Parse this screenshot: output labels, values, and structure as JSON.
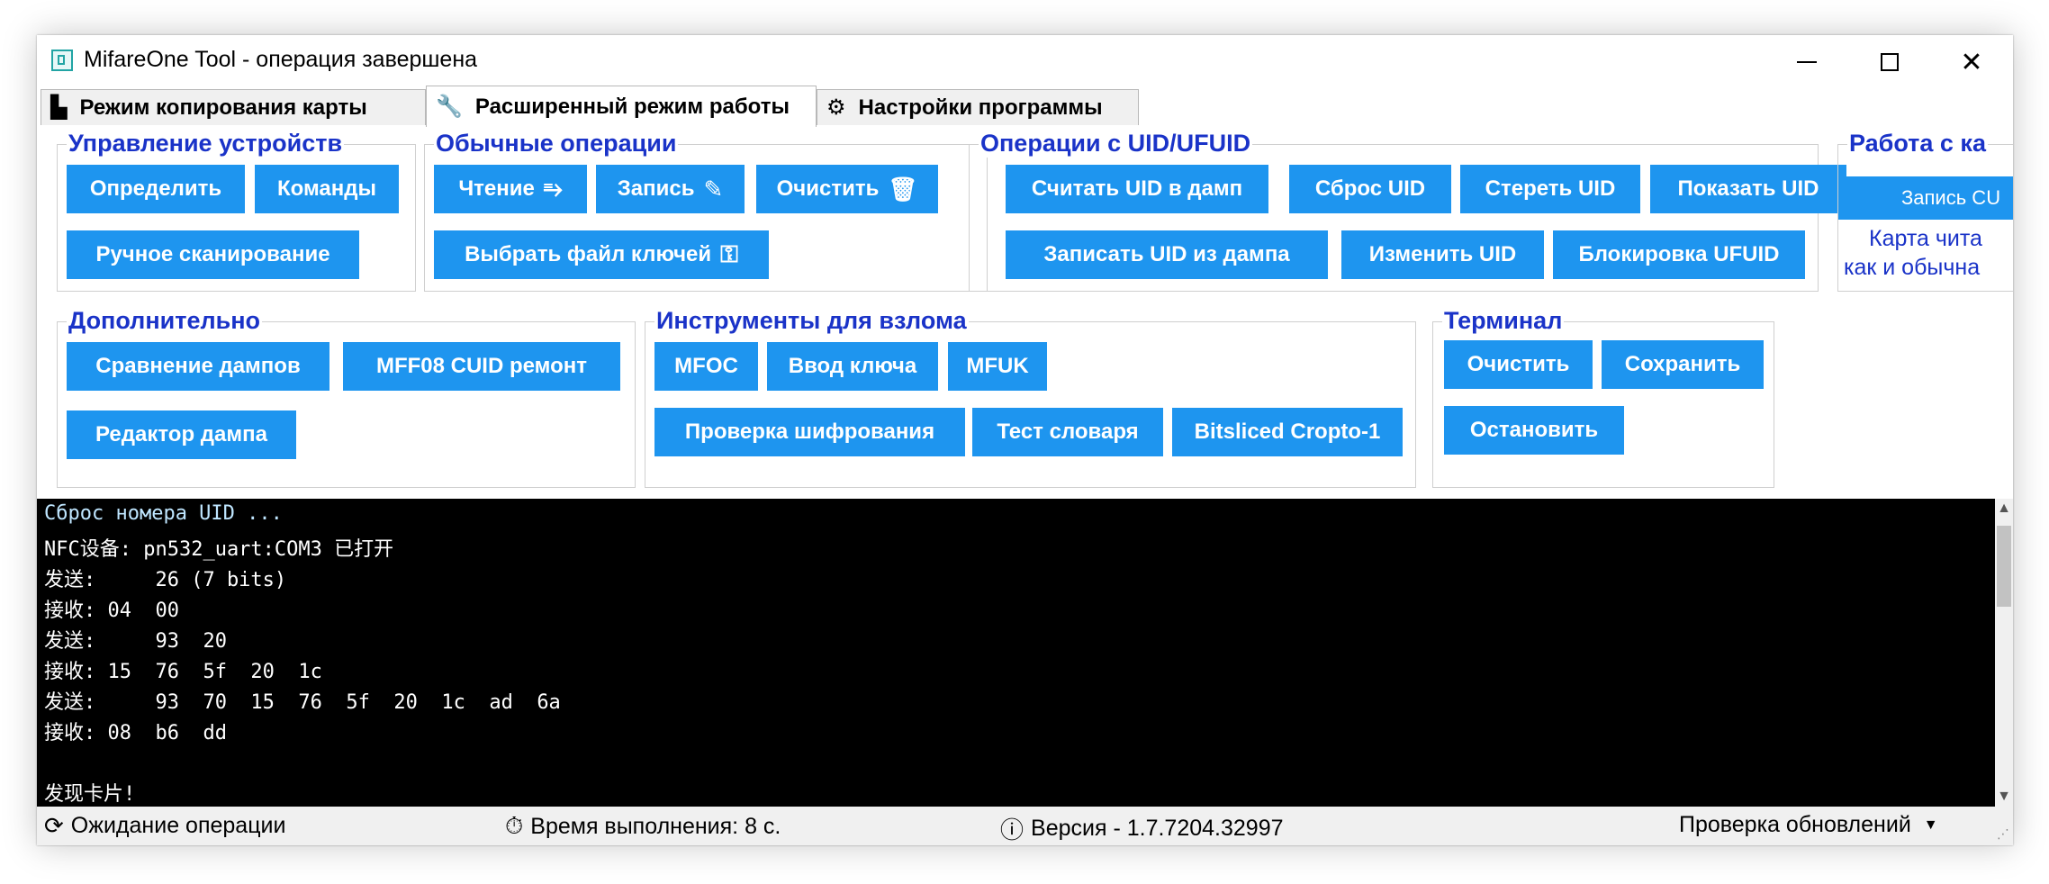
{
  "window": {
    "title": "MifareOne Tool - операция завершена",
    "minimize": "—",
    "maximize": "☐",
    "close": "✕"
  },
  "tabs": [
    {
      "label": "Режим копирования карты",
      "icon": "copy-icon",
      "glyph": "▙",
      "active": false
    },
    {
      "label": "Расширенный режим работы",
      "icon": "wrench-icon",
      "glyph": "🔧",
      "active": true
    },
    {
      "label": "Настройки программы",
      "icon": "gear-icon",
      "glyph": "⚙",
      "active": false
    }
  ],
  "groups": {
    "device": {
      "title": "Управление устройств",
      "buttons": {
        "detect": "Определить",
        "commands": "Команды",
        "manual_scan": "Ручное сканирование"
      }
    },
    "ops": {
      "title": "Обычные операции",
      "buttons": {
        "read": "Чтение",
        "write": "Запись",
        "clear": "Очистить",
        "select_keys": "Выбрать файл ключей"
      },
      "icons": {
        "read": "⥱",
        "write": "✎",
        "clear": "🗑",
        "key": "⚿"
      }
    },
    "uid": {
      "title": "Операции с UID/UFUID",
      "buttons": {
        "read_uid_dump": "Считать UID в дамп",
        "reset_uid": "Сброс UID",
        "erase_uid": "Стереть UID",
        "show_uid": "Показать UID",
        "write_uid_dump": "Записать UID из дампа",
        "change_uid": "Изменить UID",
        "lock_ufuid": "Блокировка UFUID"
      }
    },
    "work": {
      "title": "Работа с ка",
      "button": "Запись CU",
      "text1": "Карта чита",
      "text2": "как и обычна"
    },
    "extra": {
      "title": "Дополнительно",
      "buttons": {
        "compare": "Сравнение дампов",
        "mff08": "MFF08 CUID ремонт",
        "editor": "Редактор дампа"
      }
    },
    "hack": {
      "title": "Инструменты для взлома",
      "buttons": {
        "mfoc": "MFOC",
        "key_input": "Ввод ключа",
        "mfuk": "MFUK",
        "check_enc": "Проверка шифрования",
        "dict_test": "Тест словаря",
        "bitsliced": "Bitsliced Cropto-1"
      }
    },
    "terminal": {
      "title": "Терминал",
      "buttons": {
        "clear": "Очистить",
        "save": "Сохранить",
        "stop": "Остановить"
      }
    }
  },
  "console": {
    "lines": [
      "Сброс номера UID ...",
      "NFC设备: pn532_uart:COM3 已打开",
      "发送:     26 (7 bits)",
      "接收: 04  00",
      "发送:     93  20",
      "接收: 15  76  5f  20  1c",
      "发送:     93  70  15  76  5f  20  1c  ad  6a",
      "接收: 08  b6  dd",
      "",
      "发现卡片!"
    ],
    "first_line_color": "#bfe6ff"
  },
  "statusbar": {
    "status": "Ожидание операции",
    "time": "Время выполнения: 8 с.",
    "version": "Версия - 1.7.7204.32997",
    "update": "Проверка обновлений"
  },
  "colors": {
    "accent": "#1e95ef",
    "group_title": "#1a33c8"
  }
}
